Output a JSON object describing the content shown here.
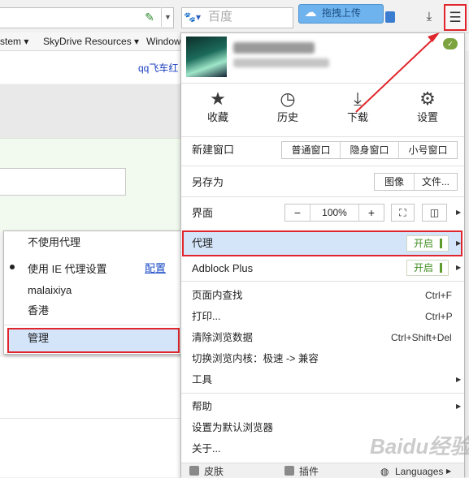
{
  "toolbar": {
    "search_placeholder": "百度",
    "upload_label": "拖拽上传"
  },
  "bookmarks": [
    {
      "label": "stem ▾"
    },
    {
      "label": "SkyDrive Resources ▾"
    },
    {
      "label": "Window"
    }
  ],
  "page": {
    "link_text": "qq飞车红"
  },
  "menu": {
    "quick_actions": [
      {
        "label": "收藏",
        "icon": "star-icon"
      },
      {
        "label": "历史",
        "icon": "clock-icon"
      },
      {
        "label": "下载",
        "icon": "download-icon"
      },
      {
        "label": "设置",
        "icon": "gear-icon"
      }
    ],
    "new_window": {
      "label": "新建窗口",
      "buttons": [
        "普通窗口",
        "隐身窗口",
        "小号窗口"
      ]
    },
    "save_as": {
      "label": "另存为",
      "buttons": [
        "图像",
        "文件..."
      ]
    },
    "zoom": {
      "label": "界面",
      "minus": "−",
      "value": "100%",
      "plus": "+"
    },
    "proxy": {
      "label": "代理",
      "status": "开启"
    },
    "adblock": {
      "label": "Adblock Plus",
      "status": "开启"
    },
    "items": [
      {
        "label": "页面内查找",
        "shortcut": "Ctrl+F"
      },
      {
        "label": "打印...",
        "shortcut": "Ctrl+P"
      },
      {
        "label": "清除浏览数据",
        "shortcut": "Ctrl+Shift+Del"
      },
      {
        "label": "切换浏览内核：极速 -> 兼容",
        "shortcut": ""
      },
      {
        "label": "工具",
        "shortcut": ""
      }
    ],
    "items2": [
      {
        "label": "帮助"
      },
      {
        "label": "设置为默认浏览器"
      },
      {
        "label": "关于..."
      }
    ],
    "footer": {
      "skin": "皮肤",
      "plugins": "插件",
      "languages": "Languages"
    }
  },
  "proxy_submenu": {
    "items": [
      "不使用代理",
      "使用 IE 代理设置",
      "malaixiya",
      "香港",
      "管理"
    ],
    "config_link": "配置"
  },
  "watermark": "Baidu经验"
}
